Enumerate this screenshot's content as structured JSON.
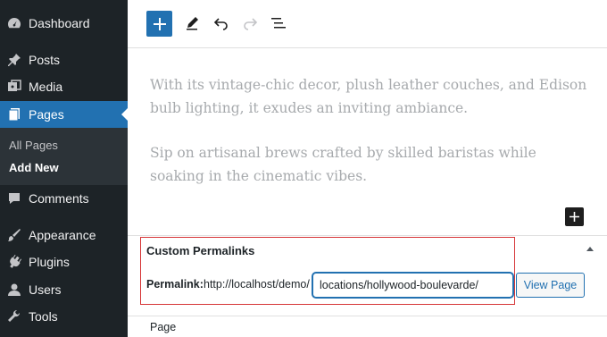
{
  "sidebar": {
    "items": [
      {
        "label": "Dashboard",
        "icon": "dashboard-icon"
      },
      {
        "label": "Posts",
        "icon": "pin-icon"
      },
      {
        "label": "Media",
        "icon": "media-icon"
      },
      {
        "label": "Pages",
        "icon": "pages-icon",
        "active": true
      },
      {
        "label": "Comments",
        "icon": "comment-icon"
      },
      {
        "label": "Appearance",
        "icon": "brush-icon"
      },
      {
        "label": "Plugins",
        "icon": "plugin-icon"
      },
      {
        "label": "Users",
        "icon": "user-icon"
      },
      {
        "label": "Tools",
        "icon": "wrench-icon"
      }
    ],
    "submenu": [
      {
        "label": "All Pages"
      },
      {
        "label": "Add New",
        "current": true
      }
    ]
  },
  "editor": {
    "paragraphs": [
      "With its vintage-chic decor, plush leather couches, and Edison bulb lighting, it exudes an inviting ambiance.",
      "Sip on artisanal brews crafted by skilled baristas while soaking in the cinematic vibes."
    ]
  },
  "permalinks": {
    "title": "Custom Permalinks",
    "label": "Permalink:",
    "base_url": "http://localhost/demo/",
    "value": "locations/hollywood-boulevarde/",
    "view_button": "View Page"
  },
  "footer_tab": "Page",
  "colors": {
    "sidebar_bg": "#1d2327",
    "accent": "#2271b1",
    "highlight_border": "#d63638"
  }
}
